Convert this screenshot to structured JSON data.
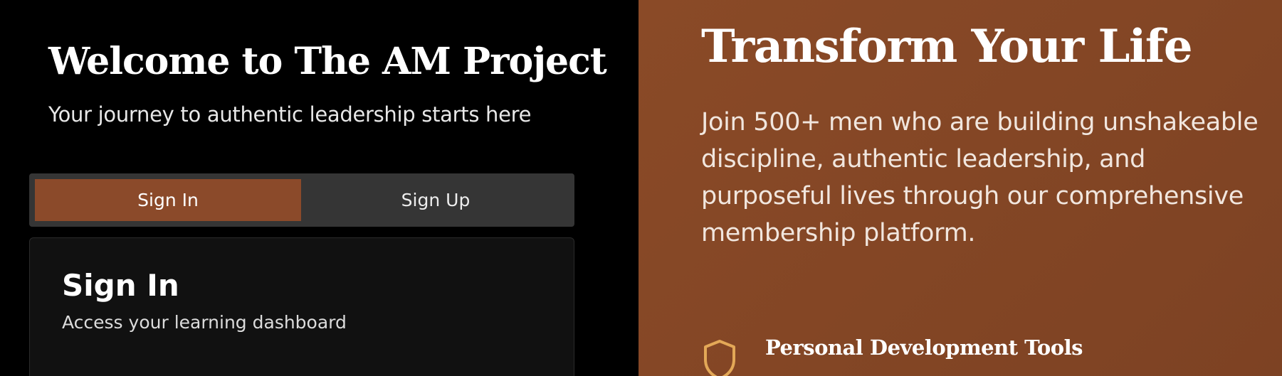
{
  "left": {
    "welcome_title": "Welcome to The AM Project",
    "tagline": "Your journey to authentic leadership starts here",
    "tabs": [
      {
        "label": "Sign In",
        "active": true
      },
      {
        "label": "Sign Up",
        "active": false
      }
    ],
    "card": {
      "title": "Sign In",
      "subtitle": "Access your learning dashboard"
    }
  },
  "right": {
    "hero_title": "Transform Your Life",
    "hero_body": "Join 500+ men who are building unshakeable discipline, authentic leadership, and purposeful lives through our comprehensive membership platform.",
    "features": [
      {
        "icon": "shield-icon",
        "title": "Personal Development Tools"
      }
    ]
  },
  "colors": {
    "accent": "#8b4a2a",
    "right_panel_bg": "#834626",
    "tabs_bg": "#353535",
    "card_bg": "#111111",
    "icon_stroke": "#e3a857"
  }
}
